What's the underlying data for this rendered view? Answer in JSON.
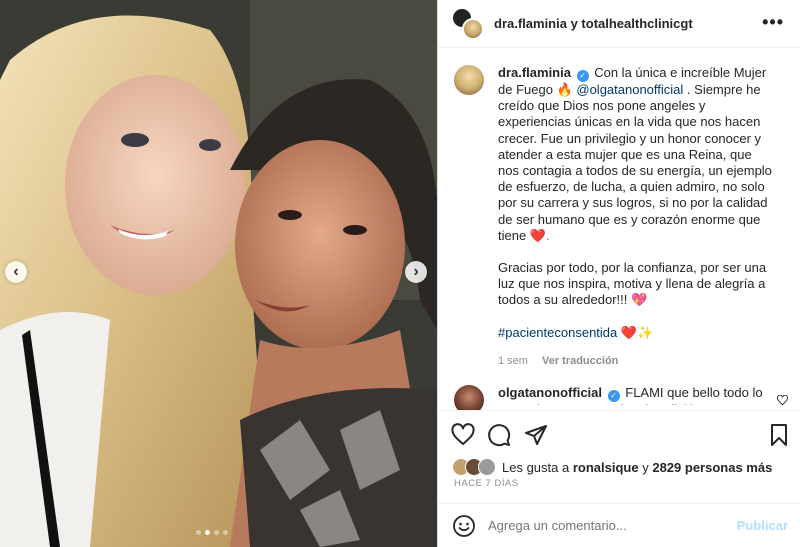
{
  "header": {
    "title": "dra.flaminia y totalhealthclinicgt",
    "more": "•••"
  },
  "post": {
    "username": "dra.flaminia",
    "verified_mark": "✓",
    "text_1": "Con la única e increíble Mujer de Fuego",
    "fire_emoji": "🔥",
    "mention": "@olgatanonofficial",
    "text_2": ". Siempre he creído que Dios nos pone angeles y experiencias únicas en la vida que nos hacen crecer. Fue un privilegio y un honor conocer y atender a esta mujer que es una Reina, que nos contagia a todos de su energía, un ejemplo de esfuerzo, de lucha, a quien admiro, no solo por su carrera y sus logros, si no por la calidad de ser humano que es y corazón enorme que tiene",
    "heart_emoji": "❤️.",
    "paragraph_2": "Gracias por todo, por la confianza, por ser una luz que nos inspira, motiva y llena de alegría a todos a su alrededor!!!",
    "heart_sparkle_emoji": "💖",
    "hashtag": "#pacienteconsentida",
    "hashtag_emojis": "❤️✨",
    "time": "1 sem",
    "see_translation": "Ver traducción"
  },
  "comment": {
    "username": "olgatanonofficial",
    "text": "FLAMI que bello todo lo que colocaste !!! Muchas bendición por"
  },
  "likes": {
    "prefix": "Les gusta a",
    "user": "ronalsique",
    "connector": "y",
    "count": "2829 personas más"
  },
  "ago": "HACE 7 DÍAS",
  "composer": {
    "placeholder": "Agrega un comentario...",
    "publish": "Publicar"
  },
  "photo": {
    "nav_left": "‹",
    "nav_right": "›",
    "slides": 4,
    "active_slide": 2
  },
  "colors": {
    "link": "#00376b",
    "verified": "#3897f0",
    "muted": "#8e8e8e",
    "publish_disabled": "#b2dffc"
  }
}
